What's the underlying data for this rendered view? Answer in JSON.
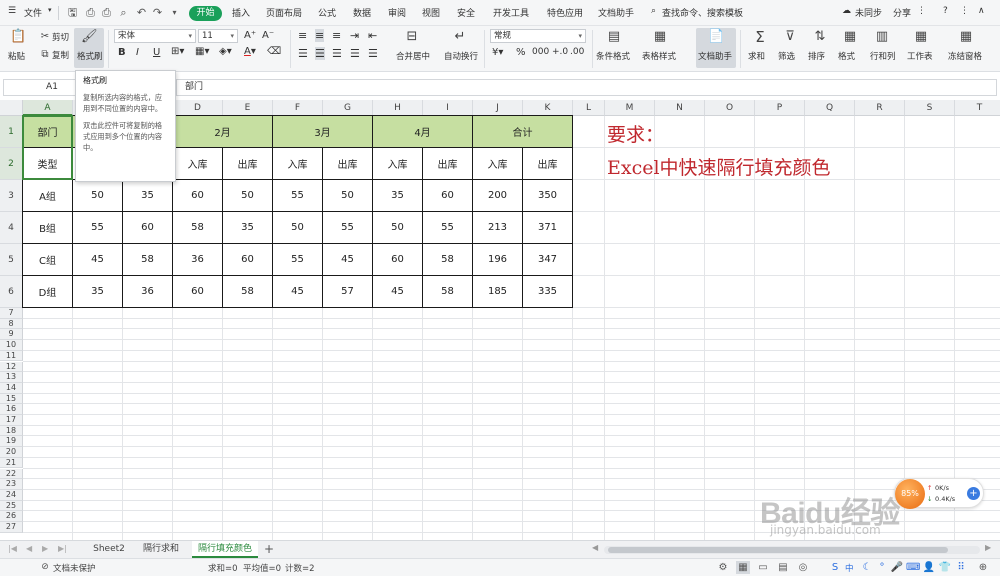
{
  "menubar": {
    "file": "文件",
    "tabs": [
      "开始",
      "插入",
      "页面布局",
      "公式",
      "数据",
      "审阅",
      "视图",
      "安全",
      "开发工具",
      "特色应用",
      "文档助手"
    ],
    "search": "查找命令、搜索模板",
    "sync": "未同步",
    "share": "分享"
  },
  "ribbon": {
    "paste": "粘贴",
    "cut": "剪切",
    "copy": "复制",
    "format_painter": "格式刷",
    "font_name": "宋体",
    "font_size": "11",
    "bold": "B",
    "italic": "I",
    "underline": "U",
    "merge_center": "合并居中",
    "wrap_text": "自动换行",
    "number_format": "常规",
    "percent": "%",
    "conditional_format": "条件格式",
    "table_style": "表格样式",
    "doc_assistant": "文档助手",
    "sum": "求和",
    "filter": "筛选",
    "sort": "排序",
    "format": "格式",
    "row_col": "行和列",
    "worksheet": "工作表",
    "freeze": "冻结窗格"
  },
  "formula_bar": {
    "cell_ref": "A1",
    "content": "部门"
  },
  "tooltip": {
    "title": "格式刷",
    "line1": "复制所选内容的格式，应用到不同位置的内容中。",
    "line2": "双击此控件可将复制的格式应用到多个位置的内容中。"
  },
  "columns": [
    "A",
    "B",
    "C",
    "D",
    "E",
    "F",
    "G",
    "H",
    "I",
    "J",
    "K",
    "L",
    "M",
    "N",
    "O",
    "P",
    "Q",
    "R",
    "S",
    "T"
  ],
  "rows": [
    "1",
    "2",
    "3",
    "4",
    "5",
    "6",
    "7",
    "8",
    "9",
    "10",
    "11",
    "12",
    "13",
    "14",
    "15",
    "16",
    "17",
    "18",
    "19",
    "20",
    "21",
    "22",
    "23",
    "24",
    "25",
    "26",
    "27"
  ],
  "table": {
    "dept_header": "部门",
    "type_header": "类型",
    "months": [
      "2月",
      "3月",
      "4月",
      "合计"
    ],
    "sub_headers": [
      "入库",
      "出库",
      "入库",
      "出库",
      "入库",
      "出库",
      "入库",
      "出库"
    ],
    "rows": [
      {
        "group": "A组",
        "values": [
          "50",
          "35",
          "60",
          "50",
          "55",
          "50",
          "35",
          "60",
          "200",
          "350"
        ]
      },
      {
        "group": "B组",
        "values": [
          "55",
          "60",
          "58",
          "35",
          "50",
          "55",
          "50",
          "55",
          "213",
          "371"
        ]
      },
      {
        "group": "C组",
        "values": [
          "45",
          "58",
          "36",
          "60",
          "55",
          "45",
          "60",
          "58",
          "196",
          "347"
        ]
      },
      {
        "group": "D组",
        "values": [
          "35",
          "36",
          "60",
          "58",
          "45",
          "57",
          "45",
          "58",
          "185",
          "335"
        ]
      }
    ]
  },
  "requirement": {
    "title": "要求：",
    "text": "Excel中快速隔行填充颜色"
  },
  "sheets": [
    "Sheet2",
    "隔行求和",
    "隔行填充颜色"
  ],
  "active_sheet": "隔行填充颜色",
  "status": {
    "protect": "文档未保护",
    "sum": "求和=0",
    "avg": "平均值=0",
    "count": "计数=2",
    "ime": "中"
  },
  "speed_widget": {
    "percent": "85%",
    "up": "0K/s",
    "down": "0.4K/s"
  },
  "watermark": {
    "brand": "Baidu经验",
    "url": "jingyan.baidu.com"
  },
  "colors": {
    "header_fill": "#c6dfa1",
    "accent_green": "#1aa05a",
    "requirement_red": "#c0282e"
  }
}
